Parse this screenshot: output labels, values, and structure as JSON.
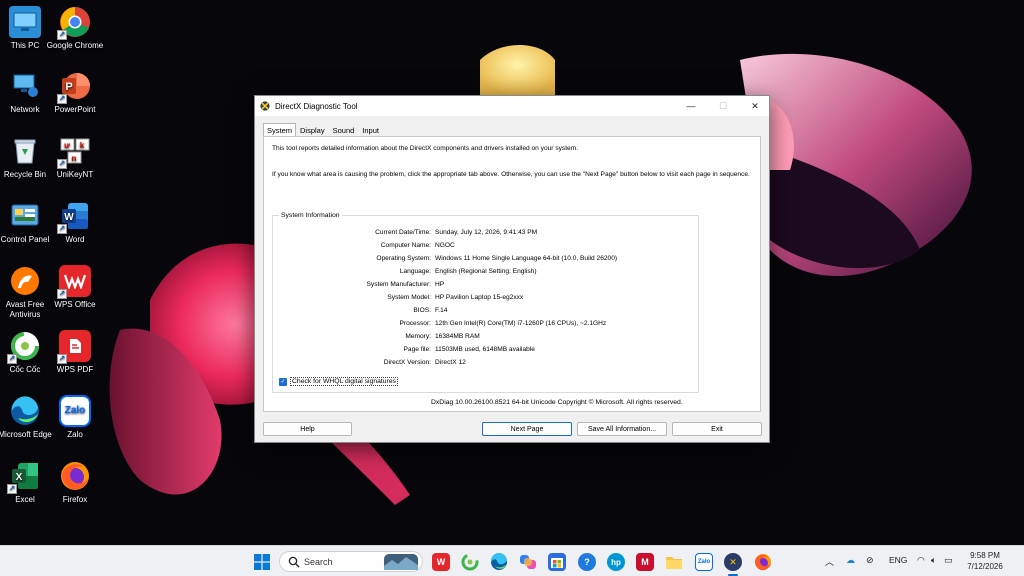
{
  "desktop": {
    "icons": [
      {
        "label": "This PC",
        "icon": "this-pc-icon"
      },
      {
        "label": "Google Chrome",
        "icon": "chrome-icon"
      },
      {
        "label": "Network",
        "icon": "network-icon"
      },
      {
        "label": "PowerPoint",
        "icon": "powerpoint-icon"
      },
      {
        "label": "Recycle Bin",
        "icon": "recycle-bin-icon"
      },
      {
        "label": "UniKeyNT",
        "icon": "unikey-icon"
      },
      {
        "label": "Control Panel",
        "icon": "control-panel-icon"
      },
      {
        "label": "Word",
        "icon": "word-icon"
      },
      {
        "label": "Avast Free Antivirus",
        "icon": "avast-icon"
      },
      {
        "label": "WPS Office",
        "icon": "wps-office-icon"
      },
      {
        "label": "Cốc Cốc",
        "icon": "coccoc-icon"
      },
      {
        "label": "WPS PDF",
        "icon": "wps-pdf-icon"
      },
      {
        "label": "Microsoft Edge",
        "icon": "edge-icon"
      },
      {
        "label": "Zalo",
        "icon": "zalo-icon"
      },
      {
        "label": "Excel",
        "icon": "excel-icon"
      },
      {
        "label": "Firefox",
        "icon": "firefox-icon"
      }
    ]
  },
  "window": {
    "title": "DirectX Diagnostic Tool",
    "tabs": [
      "System",
      "Display",
      "Sound",
      "Input"
    ],
    "intro1": "This tool reports detailed information about the DirectX components and drivers installed on your system.",
    "intro2": "If you know what area is causing the problem, click the appropriate tab above.  Otherwise, you can use the \"Next Page\" button below to visit each page in sequence.",
    "group_title": "System Information",
    "rows": [
      {
        "label": "Current Date/Time:",
        "value": "Sunday, July 12, 2026, 9:41:43 PM"
      },
      {
        "label": "Computer Name:",
        "value": "NGOC"
      },
      {
        "label": "Operating System:",
        "value": "Windows 11 Home Single Language 64-bit (10.0, Build 26200)"
      },
      {
        "label": "Language:",
        "value": "English (Regional Setting: English)"
      },
      {
        "label": "System Manufacturer:",
        "value": "HP"
      },
      {
        "label": "System Model:",
        "value": "HP Pavilion Laptop 15-eg2xxx"
      },
      {
        "label": "BIOS:",
        "value": "F.14"
      },
      {
        "label": "Processor:",
        "value": "12th Gen Intel(R) Core(TM) i7-1260P (16 CPUs), ~2.1GHz"
      },
      {
        "label": "Memory:",
        "value": "16384MB RAM"
      },
      {
        "label": "Page file:",
        "value": "11503MB used, 6148MB available"
      },
      {
        "label": "DirectX Version:",
        "value": "DirectX 12"
      }
    ],
    "whql_label": "Check for WHQL digital signatures",
    "whql_checked": true,
    "copyright": "DxDiag 10.00.26100.8521 64-bit Unicode  Copyright © Microsoft. All rights reserved.",
    "buttons": {
      "help": "Help",
      "next": "Next Page",
      "save": "Save All Information...",
      "exit": "Exit"
    }
  },
  "taskbar": {
    "search_label": "Search",
    "language": "ENG",
    "time": "9:58 PM",
    "date": "7/12/2026"
  }
}
